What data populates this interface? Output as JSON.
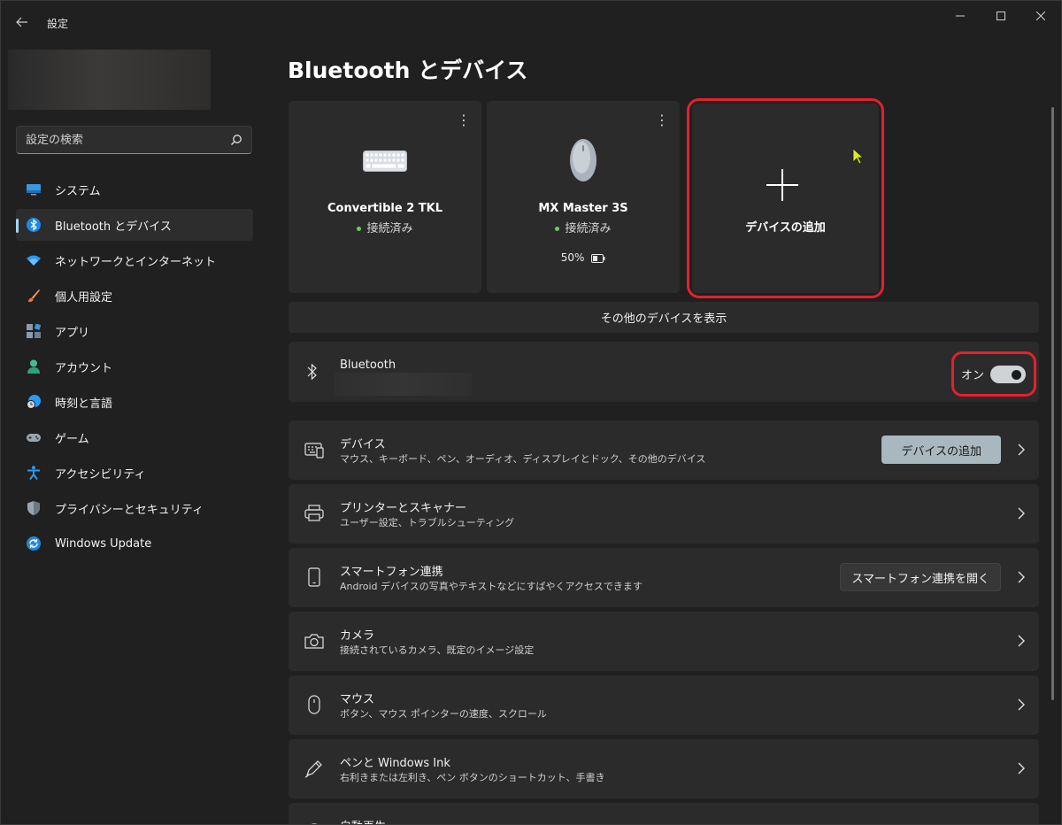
{
  "app": {
    "title": "設定"
  },
  "search": {
    "placeholder": "設定の検索"
  },
  "sidebar": {
    "items": [
      {
        "label": "システム",
        "icon": "display-icon"
      },
      {
        "label": "Bluetooth とデバイス",
        "icon": "bluetooth-icon",
        "active": true
      },
      {
        "label": "ネットワークとインターネット",
        "icon": "wifi-icon"
      },
      {
        "label": "個人用設定",
        "icon": "brush-icon"
      },
      {
        "label": "アプリ",
        "icon": "apps-icon"
      },
      {
        "label": "アカウント",
        "icon": "person-icon"
      },
      {
        "label": "時刻と言語",
        "icon": "globe-clock-icon"
      },
      {
        "label": "ゲーム",
        "icon": "gamepad-icon"
      },
      {
        "label": "アクセシビリティ",
        "icon": "accessibility-icon"
      },
      {
        "label": "プライバシーとセキュリティ",
        "icon": "shield-icon"
      },
      {
        "label": "Windows Update",
        "icon": "update-icon"
      }
    ]
  },
  "main": {
    "title": "Bluetooth とデバイス",
    "devices": [
      {
        "name": "Convertible 2 TKL",
        "status": "接続済み",
        "icon": "keyboard-icon"
      },
      {
        "name": "MX Master 3S",
        "status": "接続済み",
        "battery": "50%",
        "battery_level": 0.5,
        "icon": "mouse-icon"
      }
    ],
    "add_tile_label": "デバイスの追加",
    "more_devices_label": "その他のデバイスを表示",
    "bluetooth": {
      "label": "Bluetooth",
      "toggle_label": "オン",
      "on": true
    },
    "rows": [
      {
        "title": "デバイス",
        "desc": "マウス、キーボード、ペン、オーディオ、ディスプレイとドック、その他のデバイス",
        "button": "デバイスの追加",
        "icon": "devices-icon"
      },
      {
        "title": "プリンターとスキャナー",
        "desc": "ユーザー設定、トラブルシューティング",
        "icon": "printer-icon"
      },
      {
        "title": "スマートフォン連携",
        "desc": "Android デバイスの写真やテキストなどにすばやくアクセスできます",
        "button": "スマートフォン連携を開く",
        "icon": "phone-icon"
      },
      {
        "title": "カメラ",
        "desc": "接続されているカメラ、既定のイメージ設定",
        "icon": "camera-icon"
      },
      {
        "title": "マウス",
        "desc": "ボタン、マウス ポインターの速度、スクロール",
        "icon": "mouse-outline-icon"
      },
      {
        "title": "ペンと Windows Ink",
        "desc": "右利きまたは左利き、ペン ボタンのショートカット、手書き",
        "icon": "pen-icon"
      },
      {
        "title": "自動再生",
        "icon": "autoplay-icon"
      }
    ]
  },
  "colors": {
    "accent": "#9fd6ff",
    "highlight": "#e4202f",
    "connected": "#6ccb5f"
  }
}
